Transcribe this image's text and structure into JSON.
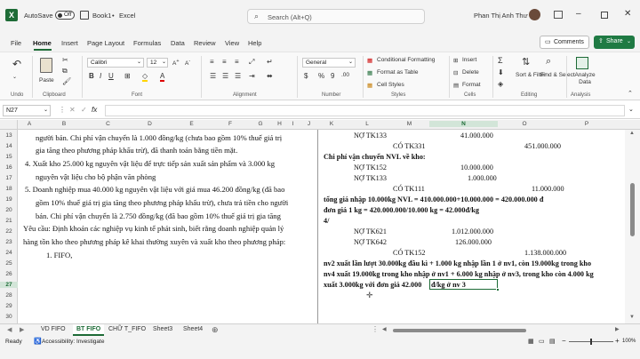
{
  "titlebar": {
    "autosave_label": "AutoSave",
    "autosave_state": "Off",
    "filename": "Book1",
    "app": "Excel",
    "search_placeholder": "Search (Alt+Q)",
    "user_name": "Phan Thị Anh Thư"
  },
  "menu": {
    "items": [
      "File",
      "Home",
      "Insert",
      "Page Layout",
      "Formulas",
      "Data",
      "Review",
      "View",
      "Help"
    ],
    "active": "Home",
    "comments_label": "Comments",
    "share_label": "Share"
  },
  "ribbon": {
    "undo_label": "Undo",
    "paste_label": "Paste",
    "clipboard_label": "Clipboard",
    "font_name": "Calibri",
    "font_size": "12",
    "font_label": "Font",
    "alignment_label": "Alignment",
    "number_format": "General",
    "number_label": "Number",
    "conditional_formatting": "Conditional Formatting",
    "format_as_table": "Format as Table",
    "cell_styles": "Cell Styles",
    "styles_label": "Styles",
    "insert_label": "Insert",
    "delete_label": "Delete",
    "format_label": "Format",
    "cells_label": "Cells",
    "sort_filter": "Sort & Filter",
    "find_select": "Find & Select",
    "editing_label": "Editing",
    "analyze_data": "Analyze Data",
    "analysis_label": "Analysis"
  },
  "formula_bar": {
    "name_box": "N27",
    "fx": "fx",
    "content": ""
  },
  "columns": [
    "A",
    "B",
    "C",
    "D",
    "E",
    "F",
    "G",
    "H",
    "I",
    "J",
    "K",
    "L",
    "M",
    "N",
    "O",
    "P"
  ],
  "rows": [
    "13",
    "14",
    "15",
    "16",
    "17",
    "18",
    "19",
    "20",
    "21",
    "22",
    "23",
    "24",
    "25",
    "26",
    "27",
    "28",
    "29",
    "30"
  ],
  "document_lines": [
    "người bán. Chi phí vận chuyển là 1.000 đồng/kg (chưa bao gồm 10% thuế giá trị",
    "gia tăng theo phương pháp khấu trừ), đã thanh toán bằng tiền mặt.",
    "4.   Xuất kho 25.000 kg nguyên vật liệu để trực tiếp sản xuất sản phẩm và 3.000 kg",
    "nguyên vật liệu cho bộ phận văn phòng",
    "5.   Doanh nghiệp mua 40.000 kg nguyên vật liệu với giá mua 46.200 đồng/kg (đã bao",
    "gồm 10% thuế giá trị gia tăng theo phương pháp khấu trừ), chưa trả tiền cho người",
    "bán. Chi phí vận chuyển là 2.750 đồng/kg (đã bao gồm 10% thuế giá trị gia tăng",
    "Yêu cầu: Định khoản các nghiệp vụ kinh tế phát sinh, biết rằng doanh nghiệp quản lý",
    "hàng tồn kho theo phương pháp kê khai thường xuyên và xuất kho theo phương pháp:",
    "1.   FIFO,"
  ],
  "cells": {
    "r13_l": "NỢ TK133",
    "r13_n": "41.000.000",
    "r14_l": "CÓ TK331",
    "r14_o": "451.000.000",
    "r15": "Chi phí vận chuyển NVL về kho:",
    "r16_l": "NỢ TK152",
    "r16_n": "10.000.000",
    "r17_l": "NỢ TK133",
    "r17_n": "1.000.000",
    "r18_l": "CÓ TK111",
    "r18_o": "11.000.000",
    "r19": "tổng giá nhập 10.000kg NVL = 410.000.000+10.000.000 = 420.000.000 đ",
    "r20": "đơn giá 1 kg = 420.000.000/10.000 kg = 42.000đ/kg",
    "r21": "4/",
    "r22_l": "NỢ TK621",
    "r22_n": "1.012.000.000",
    "r23_l": "NỢ TK642",
    "r23_n": "126.000.000",
    "r24_l": "CÓ TK152",
    "r24_o": "1.138.000.000",
    "r25": "nv2 xuất lần lượt 30.000kg đầu kì + 1.000 kg nhập lần 1 ở nv1, còn 19.000kg trong kho",
    "r26": "nv4 xuất 19.000kg trong kho nhập ở nv1 + 6.000 kg nhập ở nv3, trong kho còn 4.000 kg",
    "r27": "xuất 3.000kg với đơn giá 42.000",
    "r27_n": "đ/kg ở nv 3"
  },
  "sheet_tabs": [
    "VD FIFO",
    "BT FIFO",
    "CHỮ T_FIFO",
    "Sheet3",
    "Sheet4"
  ],
  "active_tab": "BT FIFO",
  "status": {
    "ready": "Ready",
    "accessibility": "Accessibility: Investigate",
    "zoom": "100%"
  },
  "colors": {
    "excel_green": "#1d6b36",
    "selection_border": "#1d6b36",
    "share_green": "#1f7a43"
  }
}
